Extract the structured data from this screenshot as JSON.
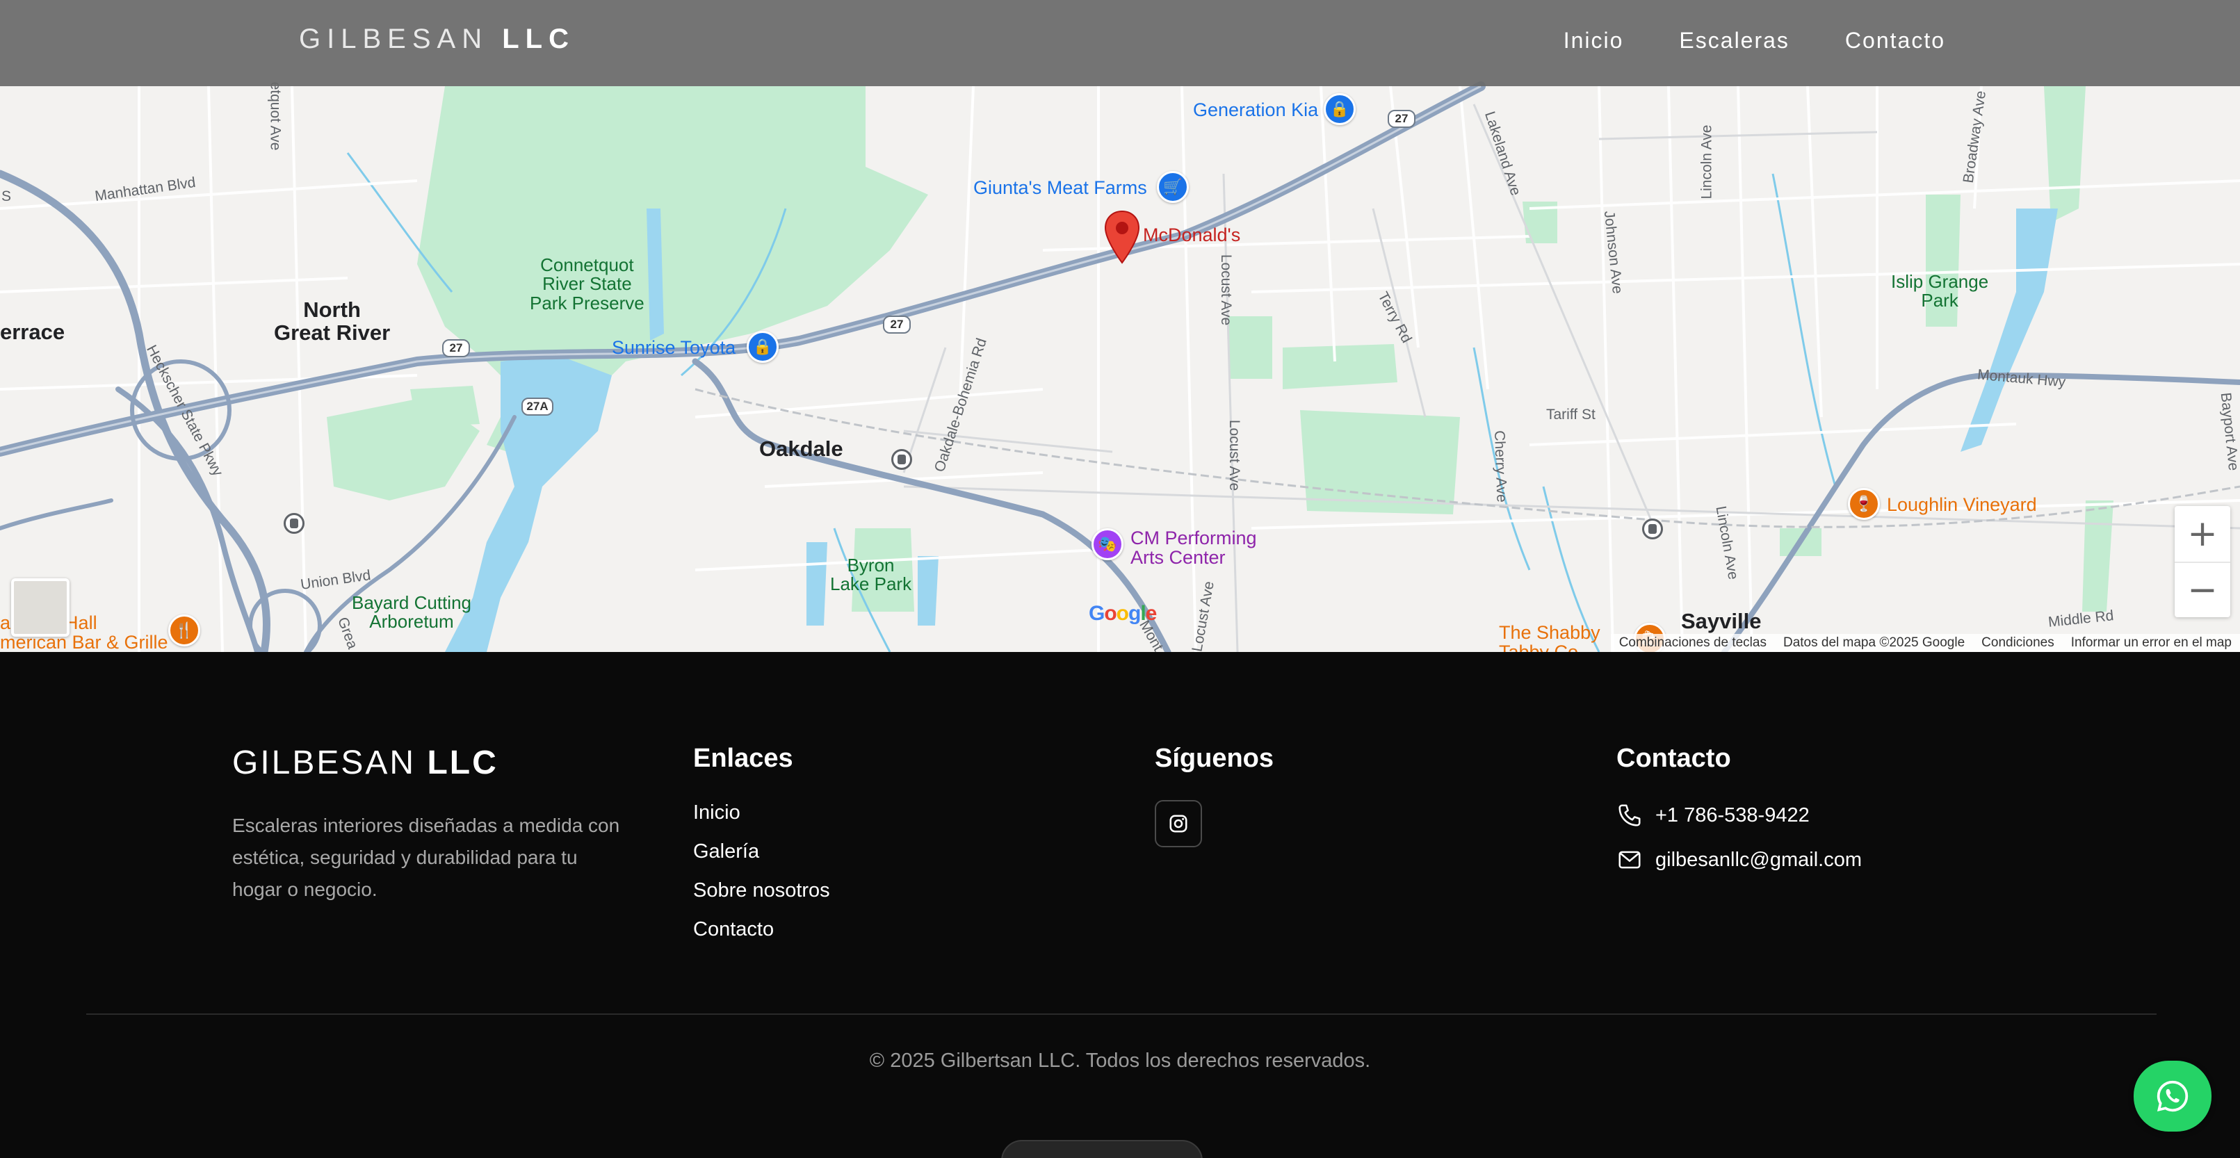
{
  "navbar": {
    "brand_light": "GILBESAN",
    "brand_bold": "LLC",
    "links": [
      "Inicio",
      "Escaleras",
      "Contacto"
    ]
  },
  "map": {
    "places": {
      "north_great_river": "North\nGreat River",
      "terrace": "errace",
      "oakdale": "Oakdale",
      "sayville": "Sayville",
      "connetquot": "Connetquot\nRiver State\nPark Preserve",
      "islip_grange": "Islip Grange\nPark",
      "byron_lake": "Byron\nLake Park",
      "bayard": "Bayard Cutting\nArboretum"
    },
    "pois": {
      "generation_kia": "Generation Kia",
      "giuntas": "Giunta's Meat Farms",
      "mcdonalds": "McDonald's",
      "sunrise_toyota": "Sunrise Toyota",
      "cm_performing": "CM Performing\nArts Center",
      "loughlin": "Loughlin Vineyard",
      "jackson_hall": "ackson Hall\nmerican Bar & Grille",
      "shabby": "The Shabby\nTabby Co"
    },
    "roads": {
      "manhattan": "Manhattan Blvd",
      "hecksher": "Heckscher State Pkwy",
      "union": "Union Blvd",
      "oakdale_bohemia": "Oakdale-Bohemia Rd",
      "locust1": "Locust Ave",
      "locust2": "Locust Ave",
      "locust3": "Locust Ave",
      "terry": "Terry Rd",
      "lakeland": "Lakeland Ave",
      "johnson": "Johnson Ave",
      "lincoln1": "Lincoln Ave",
      "lincoln2": "Lincoln Ave",
      "broadway": "Broadway Ave",
      "montauk": "Montauk Hwy",
      "tariff": "Tariff St",
      "cherry": "Cherry Ave",
      "bayport": "Bayport Ave",
      "middle": "Middle Rd",
      "connetquot_ave": "etquot Ave",
      "great": "Grea",
      "mont": "Mont",
      "s": "S"
    },
    "shields": [
      "27",
      "27",
      "27",
      "27A"
    ],
    "zoom_in": "+",
    "zoom_out": "−",
    "attribution": [
      "Combinaciones de teclas",
      "Datos del mapa ©2025 Google",
      "Condiciones",
      "Informar un error en el map"
    ]
  },
  "footer": {
    "brand_light": "GILBESAN",
    "brand_bold": "LLC",
    "description": "Escaleras interiores diseñadas a medida con estética, seguridad y durabilidad para tu hogar o negocio.",
    "links_title": "Enlaces",
    "links": [
      "Inicio",
      "Galería",
      "Sobre nosotros",
      "Contacto"
    ],
    "social_title": "Síguenos",
    "contact_title": "Contacto",
    "phone": "+1 786-538-9422",
    "email": "gilbesanllc@gmail.com",
    "copyright": "© 2025 Gilbertsan LLC. Todos los derechos reservados."
  },
  "colors": {
    "whatsapp": "#25d366",
    "map_water": "#9cd6f0",
    "map_park": "#c3ecd1",
    "highway": "#8ea2bd"
  }
}
